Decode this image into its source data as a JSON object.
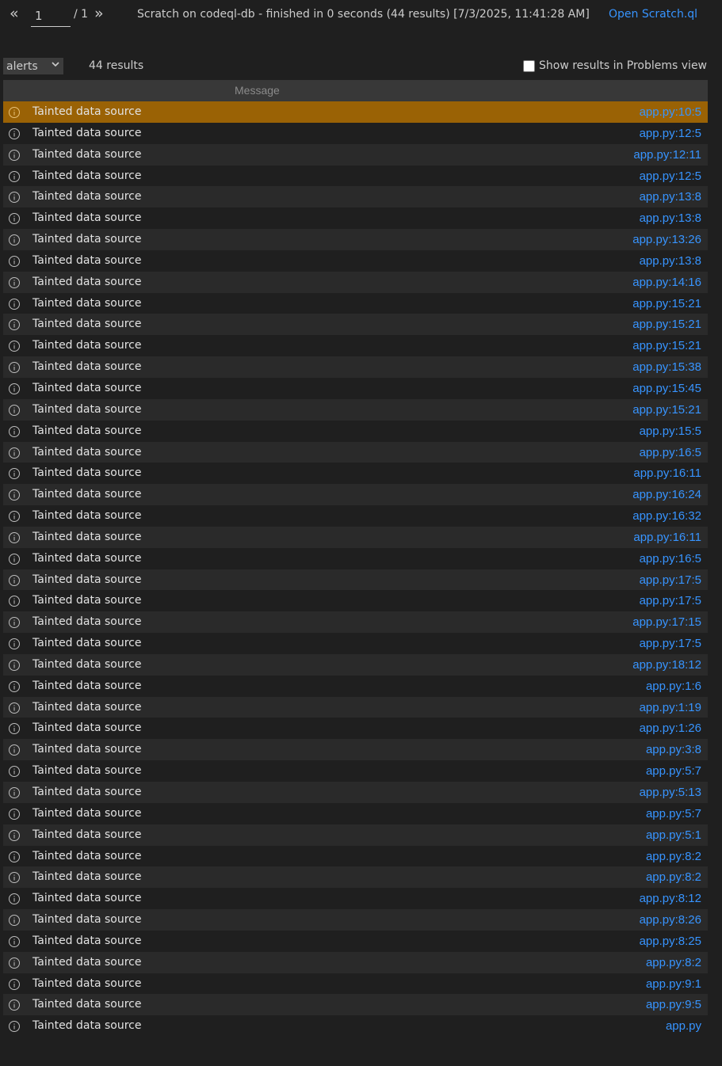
{
  "pagination": {
    "prev_icon": "double-chevron-left-icon",
    "next_icon": "double-chevron-right-icon",
    "current_page": "1",
    "total_pages": "/ 1"
  },
  "run_info": "Scratch on codeql-db - finished in 0 seconds (44 results) [7/3/2025, 11:41:28 AM]",
  "open_query_link": "Open Scratch.ql",
  "result_set": {
    "selected": "alerts"
  },
  "result_count": "44 results",
  "show_problems": {
    "label": "Show results in Problems view",
    "checked": false
  },
  "table": {
    "column_message": "Message",
    "rows": [
      {
        "message": "Tainted data source",
        "location": "app.py:10:5"
      },
      {
        "message": "Tainted data source",
        "location": "app.py:12:5"
      },
      {
        "message": "Tainted data source",
        "location": "app.py:12:11"
      },
      {
        "message": "Tainted data source",
        "location": "app.py:12:5"
      },
      {
        "message": "Tainted data source",
        "location": "app.py:13:8"
      },
      {
        "message": "Tainted data source",
        "location": "app.py:13:8"
      },
      {
        "message": "Tainted data source",
        "location": "app.py:13:26"
      },
      {
        "message": "Tainted data source",
        "location": "app.py:13:8"
      },
      {
        "message": "Tainted data source",
        "location": "app.py:14:16"
      },
      {
        "message": "Tainted data source",
        "location": "app.py:15:21"
      },
      {
        "message": "Tainted data source",
        "location": "app.py:15:21"
      },
      {
        "message": "Tainted data source",
        "location": "app.py:15:21"
      },
      {
        "message": "Tainted data source",
        "location": "app.py:15:38"
      },
      {
        "message": "Tainted data source",
        "location": "app.py:15:45"
      },
      {
        "message": "Tainted data source",
        "location": "app.py:15:21"
      },
      {
        "message": "Tainted data source",
        "location": "app.py:15:5"
      },
      {
        "message": "Tainted data source",
        "location": "app.py:16:5"
      },
      {
        "message": "Tainted data source",
        "location": "app.py:16:11"
      },
      {
        "message": "Tainted data source",
        "location": "app.py:16:24"
      },
      {
        "message": "Tainted data source",
        "location": "app.py:16:32"
      },
      {
        "message": "Tainted data source",
        "location": "app.py:16:11"
      },
      {
        "message": "Tainted data source",
        "location": "app.py:16:5"
      },
      {
        "message": "Tainted data source",
        "location": "app.py:17:5"
      },
      {
        "message": "Tainted data source",
        "location": "app.py:17:5"
      },
      {
        "message": "Tainted data source",
        "location": "app.py:17:15"
      },
      {
        "message": "Tainted data source",
        "location": "app.py:17:5"
      },
      {
        "message": "Tainted data source",
        "location": "app.py:18:12"
      },
      {
        "message": "Tainted data source",
        "location": "app.py:1:6"
      },
      {
        "message": "Tainted data source",
        "location": "app.py:1:19"
      },
      {
        "message": "Tainted data source",
        "location": "app.py:1:26"
      },
      {
        "message": "Tainted data source",
        "location": "app.py:3:8"
      },
      {
        "message": "Tainted data source",
        "location": "app.py:5:7"
      },
      {
        "message": "Tainted data source",
        "location": "app.py:5:13"
      },
      {
        "message": "Tainted data source",
        "location": "app.py:5:7"
      },
      {
        "message": "Tainted data source",
        "location": "app.py:5:1"
      },
      {
        "message": "Tainted data source",
        "location": "app.py:8:2"
      },
      {
        "message": "Tainted data source",
        "location": "app.py:8:2"
      },
      {
        "message": "Tainted data source",
        "location": "app.py:8:12"
      },
      {
        "message": "Tainted data source",
        "location": "app.py:8:26"
      },
      {
        "message": "Tainted data source",
        "location": "app.py:8:25"
      },
      {
        "message": "Tainted data source",
        "location": "app.py:8:2"
      },
      {
        "message": "Tainted data source",
        "location": "app.py:9:1"
      },
      {
        "message": "Tainted data source",
        "location": "app.py:9:5"
      },
      {
        "message": "Tainted data source",
        "location": "app.py"
      }
    ],
    "selected_row": 0,
    "row_icon": "info-circle-icon"
  },
  "colors": {
    "background": "#1f1f1f",
    "row_alt": "#2a2a2a",
    "selected_row": "#9a6205",
    "link": "#3794ff"
  }
}
